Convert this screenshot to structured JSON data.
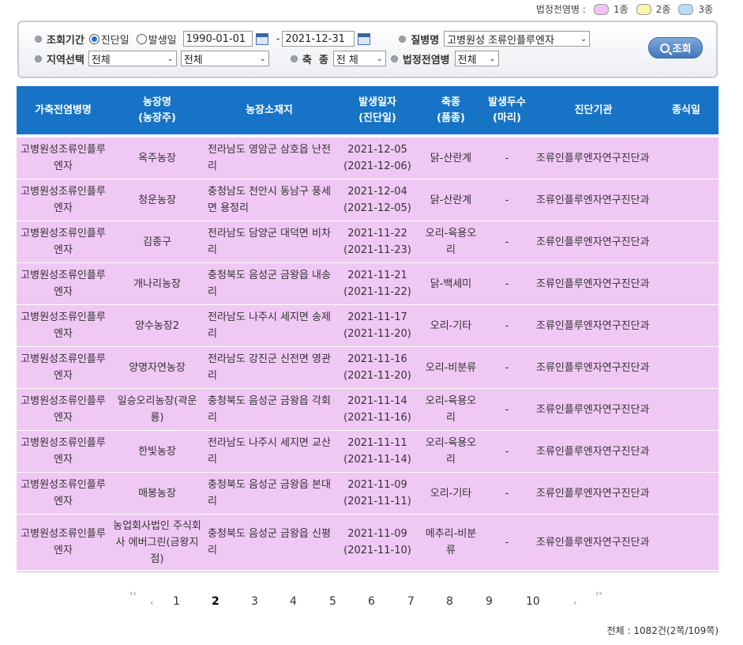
{
  "legend": {
    "title": "법정전염병 :",
    "items": [
      {
        "label": "1종",
        "color": "#f2c4f5"
      },
      {
        "label": "2종",
        "color": "#f8f6a8"
      },
      {
        "label": "3종",
        "color": "#b6dcf6"
      }
    ]
  },
  "search": {
    "period_label": "조회기간",
    "radio_diag": "진단일",
    "radio_occur": "발생일",
    "date_from": "1990-01-01",
    "date_sep": "-",
    "date_to": "2021-12-31",
    "disease_label": "질병명",
    "disease_value": "고병원성 조류인플루엔자",
    "region_label": "지역선택",
    "region1": "전체",
    "region2": "전체",
    "species_label": "축  종",
    "species_value": "전 체",
    "legal_label": "법정전염병",
    "legal_value": "전체",
    "search_button": "조회"
  },
  "table": {
    "headers": [
      "가축전염병명",
      "농장명\n(농장주)",
      "농장소재지",
      "발생일자\n(진단일)",
      "축종\n(품종)",
      "발생두수\n(마리)",
      "진단기관",
      "종식일"
    ],
    "rows": [
      {
        "disease": "고병원성조류인플루엔자",
        "farm": "옥주농장",
        "addr": "전라남도 영암군 삼호읍 난전리",
        "date": "2021-12-05",
        "diag": "(2021-12-06)",
        "species": "닭-산란계",
        "count": "-",
        "agency": "조류인플루엔자연구진단과",
        "end": ""
      },
      {
        "disease": "고병원성조류인플루엔자",
        "farm": "청운농장",
        "addr": "충청남도 천안시 동남구 풍세면 용정리",
        "date": "2021-12-04",
        "diag": "(2021-12-05)",
        "species": "닭-산란계",
        "count": "-",
        "agency": "조류인플루엔자연구진단과",
        "end": ""
      },
      {
        "disease": "고병원성조류인플루엔자",
        "farm": "김종구",
        "addr": "전라남도 담양군 대덕면 비차리",
        "date": "2021-11-22",
        "diag": "(2021-11-23)",
        "species": "오리-육용오리",
        "count": "-",
        "agency": "조류인플루엔자연구진단과",
        "end": ""
      },
      {
        "disease": "고병원성조류인플루엔자",
        "farm": "개나리농장",
        "addr": "충청북도 음성군 금왕읍 내송리",
        "date": "2021-11-21",
        "diag": "(2021-11-22)",
        "species": "닭-백세미",
        "count": "-",
        "agency": "조류인플루엔자연구진단과",
        "end": ""
      },
      {
        "disease": "고병원성조류인플루엔자",
        "farm": "양수농장2",
        "addr": "전라남도 나주시 세지면 송제리",
        "date": "2021-11-17",
        "diag": "(2021-11-20)",
        "species": "오리-기타",
        "count": "-",
        "agency": "조류인플루엔자연구진단과",
        "end": ""
      },
      {
        "disease": "고병원성조류인플루엔자",
        "farm": "양명자연농장",
        "addr": "전라남도 강진군 신전면 영관리",
        "date": "2021-11-16",
        "diag": "(2021-11-20)",
        "species": "오리-비분류",
        "count": "-",
        "agency": "조류인플루엔자연구진단과",
        "end": ""
      },
      {
        "disease": "고병원성조류인플루엔자",
        "farm": "일승오리농장(곽운룡)",
        "addr": "충청북도 음성군 금왕읍 각회리",
        "date": "2021-11-14",
        "diag": "(2021-11-16)",
        "species": "오리-육용오리",
        "count": "-",
        "agency": "조류인플루엔자연구진단과",
        "end": ""
      },
      {
        "disease": "고병원성조류인플루엔자",
        "farm": "한빛농장",
        "addr": "전라남도 나주시 세지면 교산리",
        "date": "2021-11-11",
        "diag": "(2021-11-14)",
        "species": "오리-육용오리",
        "count": "-",
        "agency": "조류인플루엔자연구진단과",
        "end": ""
      },
      {
        "disease": "고병원성조류인플루엔자",
        "farm": "매봉농장",
        "addr": "충청북도 음성군 금왕읍 본대리",
        "date": "2021-11-09",
        "diag": "(2021-11-11)",
        "species": "오리-기타",
        "count": "-",
        "agency": "조류인플루엔자연구진단과",
        "end": ""
      },
      {
        "disease": "고병원성조류인플루엔자",
        "farm": "농업회사법인 주식회사 에버그린(금왕지점)",
        "addr": "충청북도 음성군 금왕읍 신평리",
        "date": "2021-11-09",
        "diag": "(2021-11-10)",
        "species": "메추리-비분류",
        "count": "-",
        "agency": "조류인플루엔자연구진단과",
        "end": ""
      }
    ]
  },
  "pager": {
    "first": "‹‹",
    "prev": "‹",
    "pages": [
      "1",
      "2",
      "3",
      "4",
      "5",
      "6",
      "7",
      "8",
      "9",
      "10"
    ],
    "current": "2",
    "next": "›",
    "last": "››"
  },
  "total": "전체 : 1082건(2쪽/109쪽)"
}
